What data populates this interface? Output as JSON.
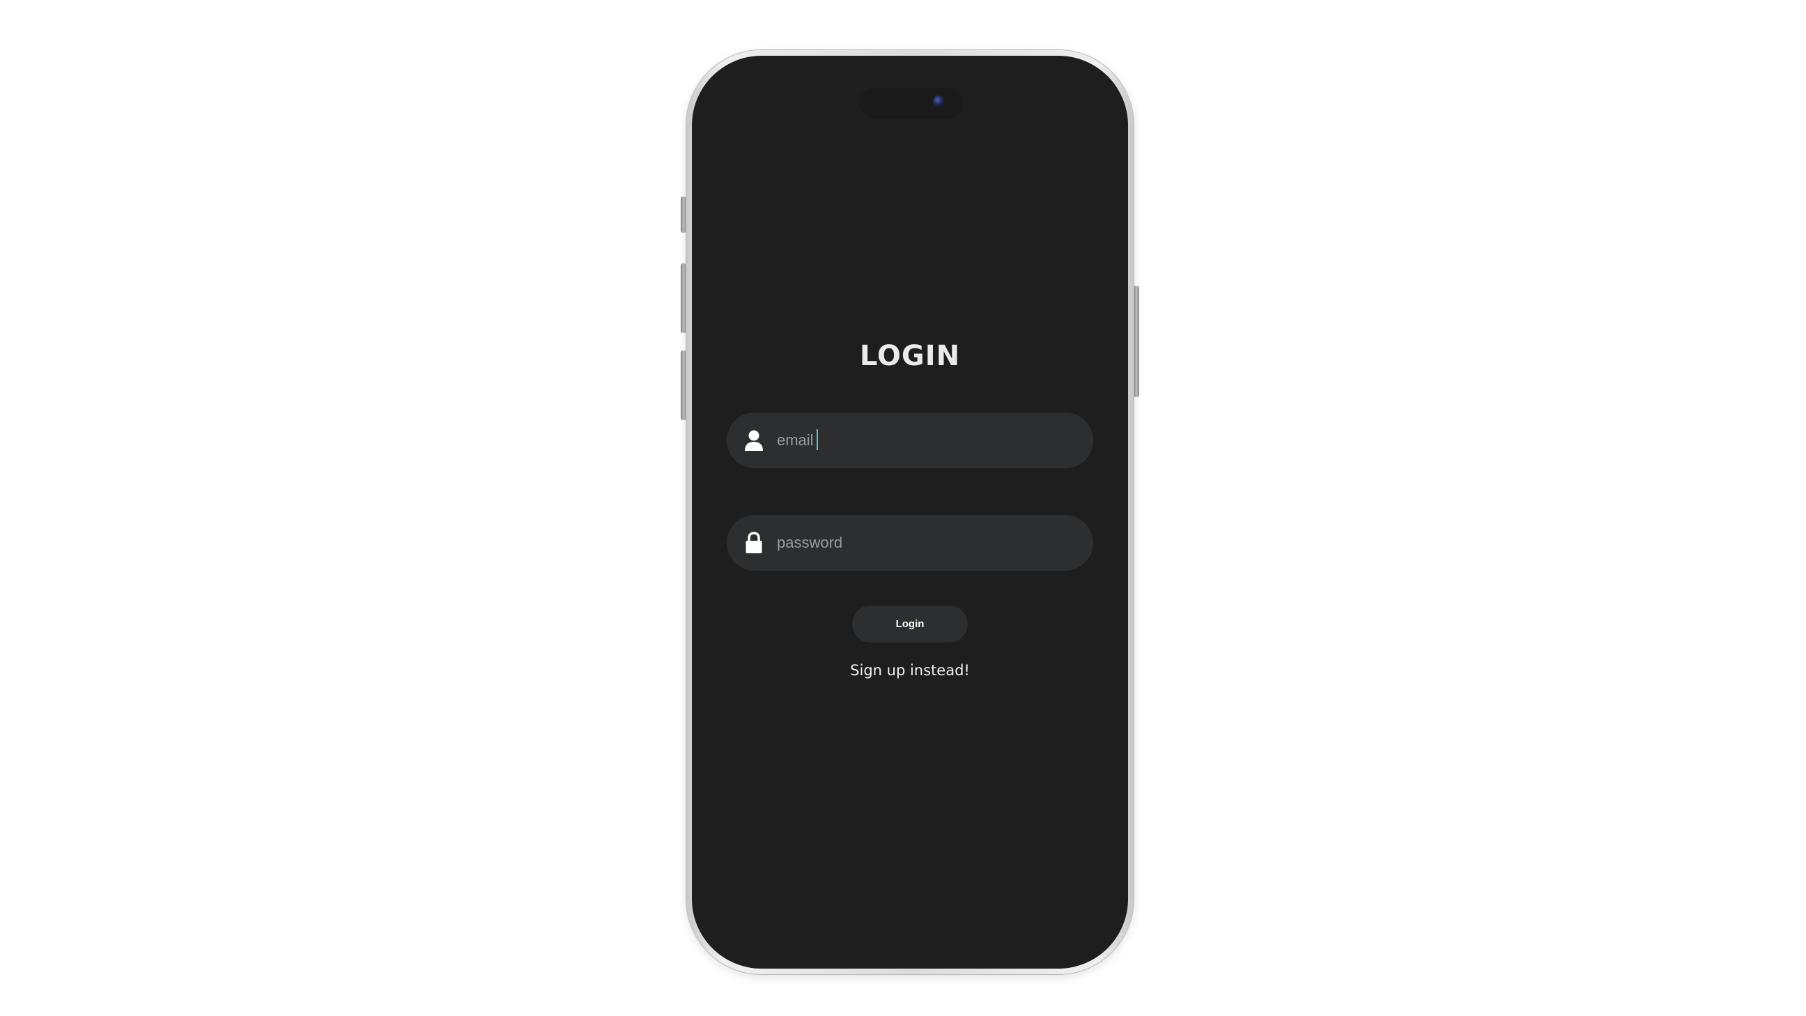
{
  "login_screen": {
    "title": "LOGIN",
    "email_field": {
      "placeholder": "email",
      "value": "",
      "icon": "user-icon"
    },
    "password_field": {
      "placeholder": "password",
      "value": "",
      "icon": "lock-icon"
    },
    "login_button_label": "Login",
    "signup_link_label": "Sign up instead!"
  },
  "colors": {
    "screen_background": "#1e1e1e",
    "field_background": "#2c2e30",
    "text_primary": "#ebebeb",
    "placeholder": "#9a9a9a",
    "caret": "#55c9c0"
  }
}
